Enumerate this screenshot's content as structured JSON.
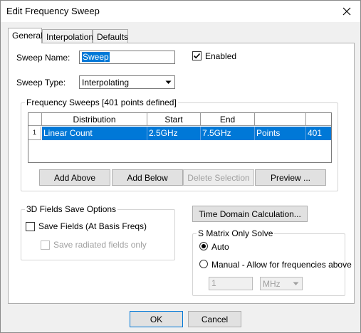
{
  "window": {
    "title": "Edit Frequency Sweep"
  },
  "tabs": [
    {
      "label": "General"
    },
    {
      "label": "Interpolation"
    },
    {
      "label": "Defaults"
    }
  ],
  "general": {
    "sweep_name_label": "Sweep Name:",
    "sweep_name_value": "Sweep",
    "enabled_label": "Enabled",
    "enabled_checked": true,
    "sweep_type_label": "Sweep Type:",
    "sweep_type_value": "Interpolating",
    "freq_sweeps": {
      "group_label": "Frequency Sweeps [401 points defined]",
      "columns": [
        "Distribution",
        "Start",
        "End",
        "",
        ""
      ],
      "rows": [
        {
          "index": "1",
          "cells": [
            "Linear Count",
            "2.5GHz",
            "7.5GHz",
            "Points",
            "401"
          ]
        }
      ],
      "buttons": {
        "add_above": "Add Above",
        "add_below": "Add Below",
        "delete_selection": "Delete Selection",
        "preview": "Preview ..."
      }
    },
    "fields_save": {
      "group_label": "3D Fields Save Options",
      "save_fields_label": "Save Fields (At Basis Freqs)",
      "save_radiated_label": "Save radiated fields only"
    },
    "time_domain_button": "Time Domain Calculation...",
    "s_matrix": {
      "group_label": "S Matrix Only Solve",
      "auto_label": "Auto",
      "manual_label": "Manual -  Allow for frequencies above",
      "manual_value": "1",
      "unit_value": "MHz"
    }
  },
  "footer": {
    "ok": "OK",
    "cancel": "Cancel"
  }
}
